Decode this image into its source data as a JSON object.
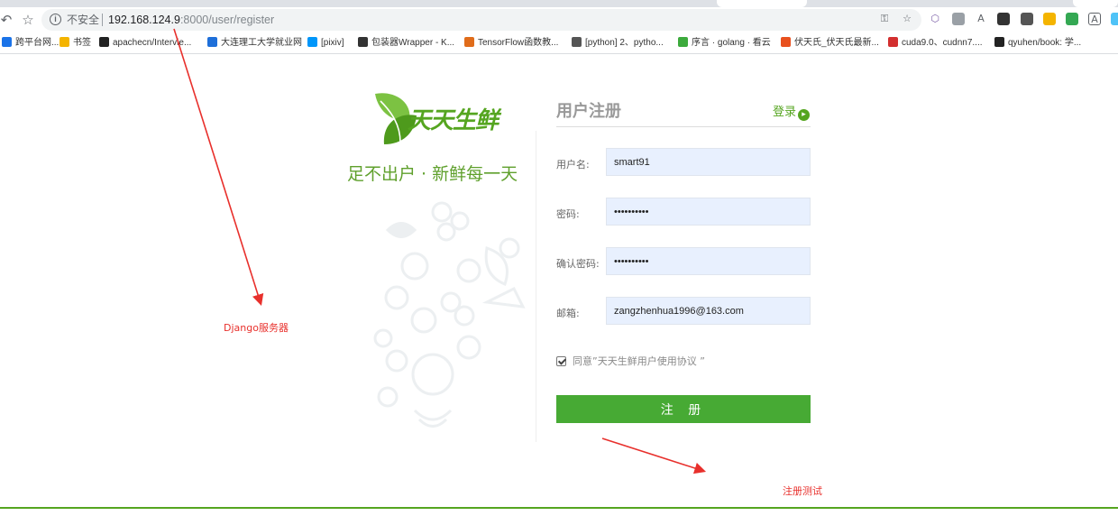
{
  "browser": {
    "address_bar": {
      "security_label": "不安全",
      "host": "192.168.124.9",
      "path": ":8000/user/register"
    },
    "bookmarks": [
      {
        "label": "跨平台网...",
        "icon": "page-icon",
        "color": "#1a73e8"
      },
      {
        "label": "书签",
        "icon": "folder-icon",
        "color": "#f4b400"
      },
      {
        "label": "apachecn/Intervie...",
        "icon": "github-icon",
        "color": "#222222"
      },
      {
        "label": "大连理工大学就业网",
        "icon": "globe-icon",
        "color": "#1e6fd9"
      },
      {
        "label": "[pixiv]",
        "icon": "pixiv-icon",
        "color": "#0096fa"
      },
      {
        "label": "包装器Wrapper - K...",
        "icon": "book-icon",
        "color": "#333333"
      },
      {
        "label": "TensorFlow函数教...",
        "icon": "tensorflow-icon",
        "color": "#e06c1a"
      },
      {
        "label": "[python] 2、pytho...",
        "icon": "bird-icon",
        "color": "#555555"
      },
      {
        "label": "序言 · golang · 看云",
        "icon": "cloud-icon",
        "color": "#3caa3c"
      },
      {
        "label": "伏天氏_伏天氏最新...",
        "icon": "bookmark-icon",
        "color": "#e8501e"
      },
      {
        "label": "cuda9.0、cudnn7....",
        "icon": "c-icon",
        "color": "#d32f2f"
      },
      {
        "label": "qyuhen/book: 学...",
        "icon": "github-icon",
        "color": "#222222"
      }
    ]
  },
  "site": {
    "logo_text": "天天生鲜",
    "slogan": "足不出户 · 新鲜每一天"
  },
  "form": {
    "title": "用户注册",
    "login_link": "登录",
    "fields": {
      "username": {
        "label": "用户名:",
        "value": "smart91"
      },
      "password": {
        "label": "密码:",
        "value": "••••••••••"
      },
      "confirm": {
        "label": "确认密码:",
        "value": "••••••••••"
      },
      "email": {
        "label": "邮箱:",
        "value": "zangzhenhua1996@163.com"
      }
    },
    "agree_text": "同意”天天生鲜用户使用协议 ”",
    "agree_checked": true,
    "submit_label": "注 册"
  },
  "annotations": {
    "server_note": "Django服务器",
    "test_note": "注册测试",
    "color": "#e8302c"
  },
  "colors": {
    "brand_green": "#55a520",
    "button_green": "#47aa34"
  }
}
